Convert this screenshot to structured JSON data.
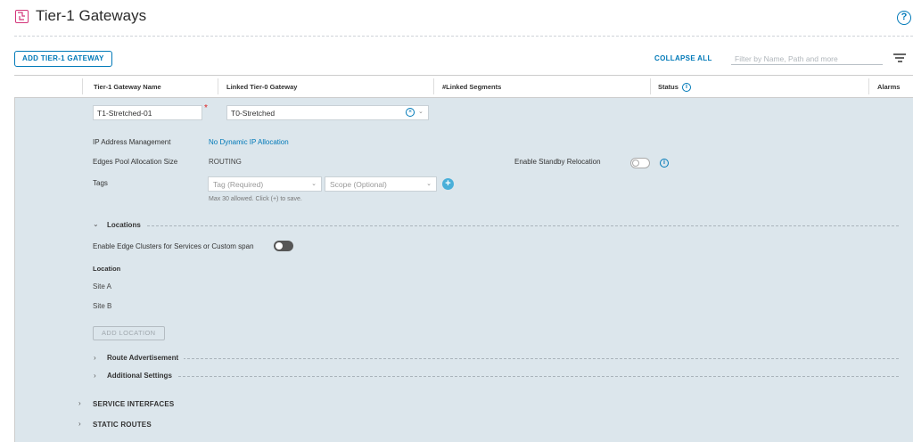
{
  "page": {
    "title": "Tier-1 Gateways",
    "help_glyph": "?"
  },
  "toolbar": {
    "add_label": "ADD TIER-1 GATEWAY",
    "collapse_all_label": "COLLAPSE ALL",
    "filter_placeholder": "Filter by Name, Path and more"
  },
  "table": {
    "columns": {
      "name": "Tier-1 Gateway Name",
      "linked_t0": "Linked Tier-0 Gateway",
      "segments": "#Linked Segments",
      "status": "Status",
      "alarms": "Alarms"
    }
  },
  "row": {
    "name_value": "T1-Stretched-01",
    "required_mark": "*",
    "linked_t0_value": "T0-Stretched",
    "ipam_label": "IP Address Management",
    "ipam_value": "No Dynamic IP Allocation",
    "edges_pool_label": "Edges Pool Allocation Size",
    "edges_pool_value": "ROUTING",
    "standby_label": "Enable Standby Relocation",
    "standby_enabled": false,
    "tags_label": "Tags",
    "tag_placeholder": "Tag (Required)",
    "scope_placeholder": "Scope (Optional)",
    "tags_hint": "Max 30 allowed. Click (+) to save."
  },
  "locations": {
    "title": "Locations",
    "edge_clusters_label": "Enable Edge Clusters for Services or Custom span",
    "edge_clusters_enabled": false,
    "column_header": "Location",
    "sites": [
      "Site A",
      "Site B"
    ],
    "add_label": "ADD LOCATION"
  },
  "sections": {
    "route_advertisement": "Route Advertisement",
    "additional_settings": "Additional Settings",
    "service_interfaces": "SERVICE INTERFACES",
    "static_routes": "STATIC ROUTES"
  },
  "colors": {
    "accent": "#0079b8",
    "brand": "#d3357a",
    "panel_bg": "#dce6ec"
  },
  "icons": [
    "tier1-gateway-icon",
    "help-icon",
    "filter-icon",
    "info-icon",
    "clear-icon",
    "chevron-down-icon",
    "plus-icon",
    "chevron-right-icon"
  ]
}
